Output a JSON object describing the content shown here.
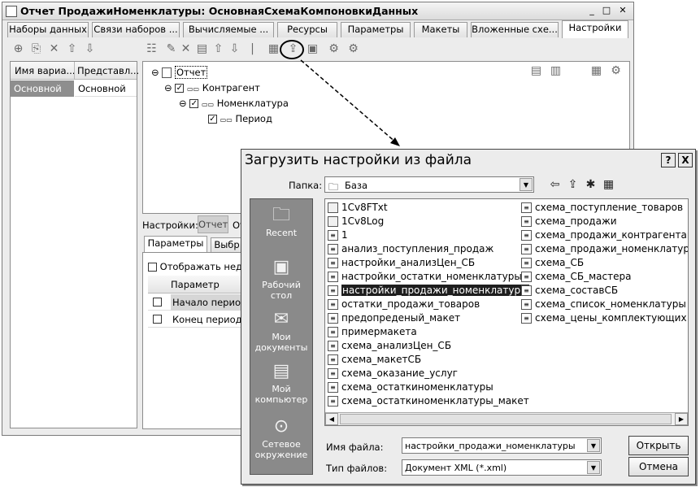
{
  "main": {
    "title": "Отчет ПродажиНоменклатуры: ОсновнаяСхемаКомпоновкиДанных",
    "tabs": [
      "Наборы данных",
      "Связи наборов ...",
      "Вычисляемые ...",
      "Ресурсы",
      "Параметры",
      "Макеты",
      "Вложенные схе...",
      "Настройки"
    ],
    "active_tab": "Настройки",
    "variants": {
      "columns": [
        "Имя вариа...",
        "Представл..."
      ],
      "rows": [
        {
          "name": "Основной",
          "repr": "Основной"
        }
      ]
    },
    "tree": {
      "root": "Отчет",
      "items": [
        "Контрагент",
        "Номенклатура",
        "Период"
      ]
    },
    "settings_label": "Настройки:",
    "settings_value": "Отчет",
    "settings_value_cut": "От",
    "subtabs": [
      "Параметры",
      "Выбр"
    ],
    "show_unavailable": "Отображать недост",
    "params": {
      "column": "Параметр",
      "rows": [
        "Начало периода",
        "Конец периода"
      ]
    }
  },
  "dialog": {
    "title": "Загрузить настройки из файла",
    "help": "?",
    "close": "X",
    "folder_label": "Папка:",
    "folder_value": "База",
    "places": [
      "Recent",
      "Рабочий стол",
      "Мои документы",
      "Мой компьютер",
      "Сетевое окружение"
    ],
    "files_col1": [
      {
        "name": "1Cv8FTxt",
        "type": "folder"
      },
      {
        "name": "1Cv8Log",
        "type": "folder"
      },
      {
        "name": "1",
        "type": "file"
      },
      {
        "name": "анализ_поступления_продаж",
        "type": "file"
      },
      {
        "name": "настройки_анализЦен_СБ",
        "type": "file"
      },
      {
        "name": "настройки_остатки_номенклатуры",
        "type": "file"
      },
      {
        "name": "настройки_продажи_номенклатуры",
        "type": "file",
        "selected": true
      },
      {
        "name": "остатки_продажи_товаров",
        "type": "file"
      },
      {
        "name": "предопреденый_макет",
        "type": "file"
      },
      {
        "name": "примермакета",
        "type": "file"
      },
      {
        "name": "схема_анализЦен_СБ",
        "type": "file"
      },
      {
        "name": "схема_макетСБ",
        "type": "file"
      },
      {
        "name": "схема_оказание_услуг",
        "type": "file"
      },
      {
        "name": "схема_остаткиноменклатуры",
        "type": "file"
      },
      {
        "name": "схема_остаткиноменклатуры_макет",
        "type": "file"
      }
    ],
    "files_col2": [
      {
        "name": "схема_поступление_товаров",
        "type": "file"
      },
      {
        "name": "схема_продажи",
        "type": "file"
      },
      {
        "name": "схема_продажи_контрагентам",
        "type": "file"
      },
      {
        "name": "схема_продажи_номенклатуры",
        "type": "file"
      },
      {
        "name": "схема_СБ",
        "type": "file"
      },
      {
        "name": "схема_СБ_мастера",
        "type": "file"
      },
      {
        "name": "схема_составСБ",
        "type": "file"
      },
      {
        "name": "схема_список_номенклатуры",
        "type": "file"
      },
      {
        "name": "схема_цены_комплектующих",
        "type": "file"
      }
    ],
    "filename_label": "Имя файла:",
    "filename_value": "настройки_продажи_номенклатуры",
    "filetype_label": "Тип файлов:",
    "filetype_value": "Документ XML (*.xml)",
    "open_button": "Открыть",
    "cancel_button": "Отмена"
  }
}
